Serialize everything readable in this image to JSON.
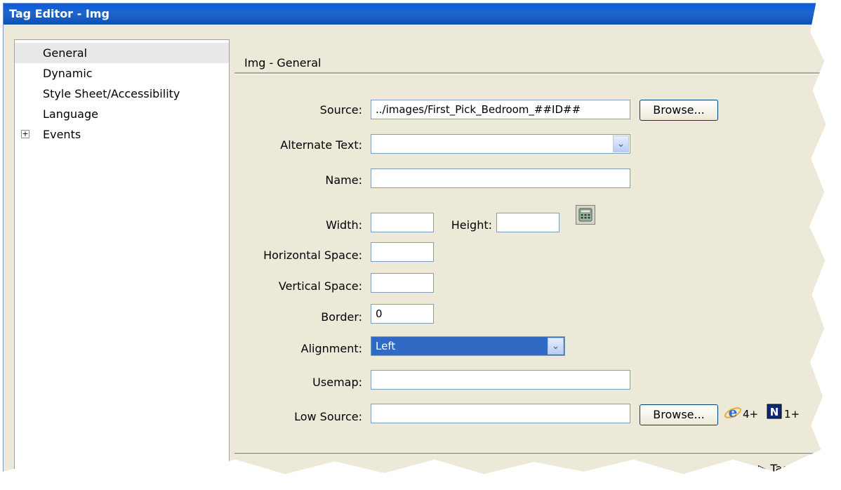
{
  "window": {
    "title": "Tag Editor - Img"
  },
  "sidebar": {
    "items": [
      {
        "label": "General",
        "selected": true
      },
      {
        "label": "Dynamic"
      },
      {
        "label": "Style Sheet/Accessibility"
      },
      {
        "label": "Language"
      },
      {
        "label": "Events",
        "expander": "+"
      }
    ]
  },
  "section": {
    "title": "Img - General"
  },
  "form": {
    "source": {
      "label": "Source:",
      "value": "../images/First_Pick_Bedroom_##ID##",
      "browse": "Browse..."
    },
    "alt_text": {
      "label": "Alternate Text:",
      "value": ""
    },
    "name": {
      "label": "Name:",
      "value": ""
    },
    "width": {
      "label": "Width:",
      "value": ""
    },
    "height": {
      "label": "Height:",
      "value": ""
    },
    "hspace": {
      "label": "Horizontal Space:",
      "value": ""
    },
    "vspace": {
      "label": "Vertical Space:",
      "value": ""
    },
    "border": {
      "label": "Border:",
      "value": "0"
    },
    "alignment": {
      "label": "Alignment:",
      "value": "Left"
    },
    "usemap": {
      "label": "Usemap:",
      "value": ""
    },
    "low_source": {
      "label": "Low Source:",
      "value": "",
      "browse": "Browse..."
    },
    "browser_support": {
      "ie": "4+",
      "ns": "1+"
    }
  },
  "footer": {
    "tag_info": "▷ Tag In"
  },
  "icons": {
    "dropdown": "chevron-down-icon",
    "calculator": "calculator-icon",
    "ie": "internet-explorer-icon",
    "netscape": "netscape-icon"
  }
}
